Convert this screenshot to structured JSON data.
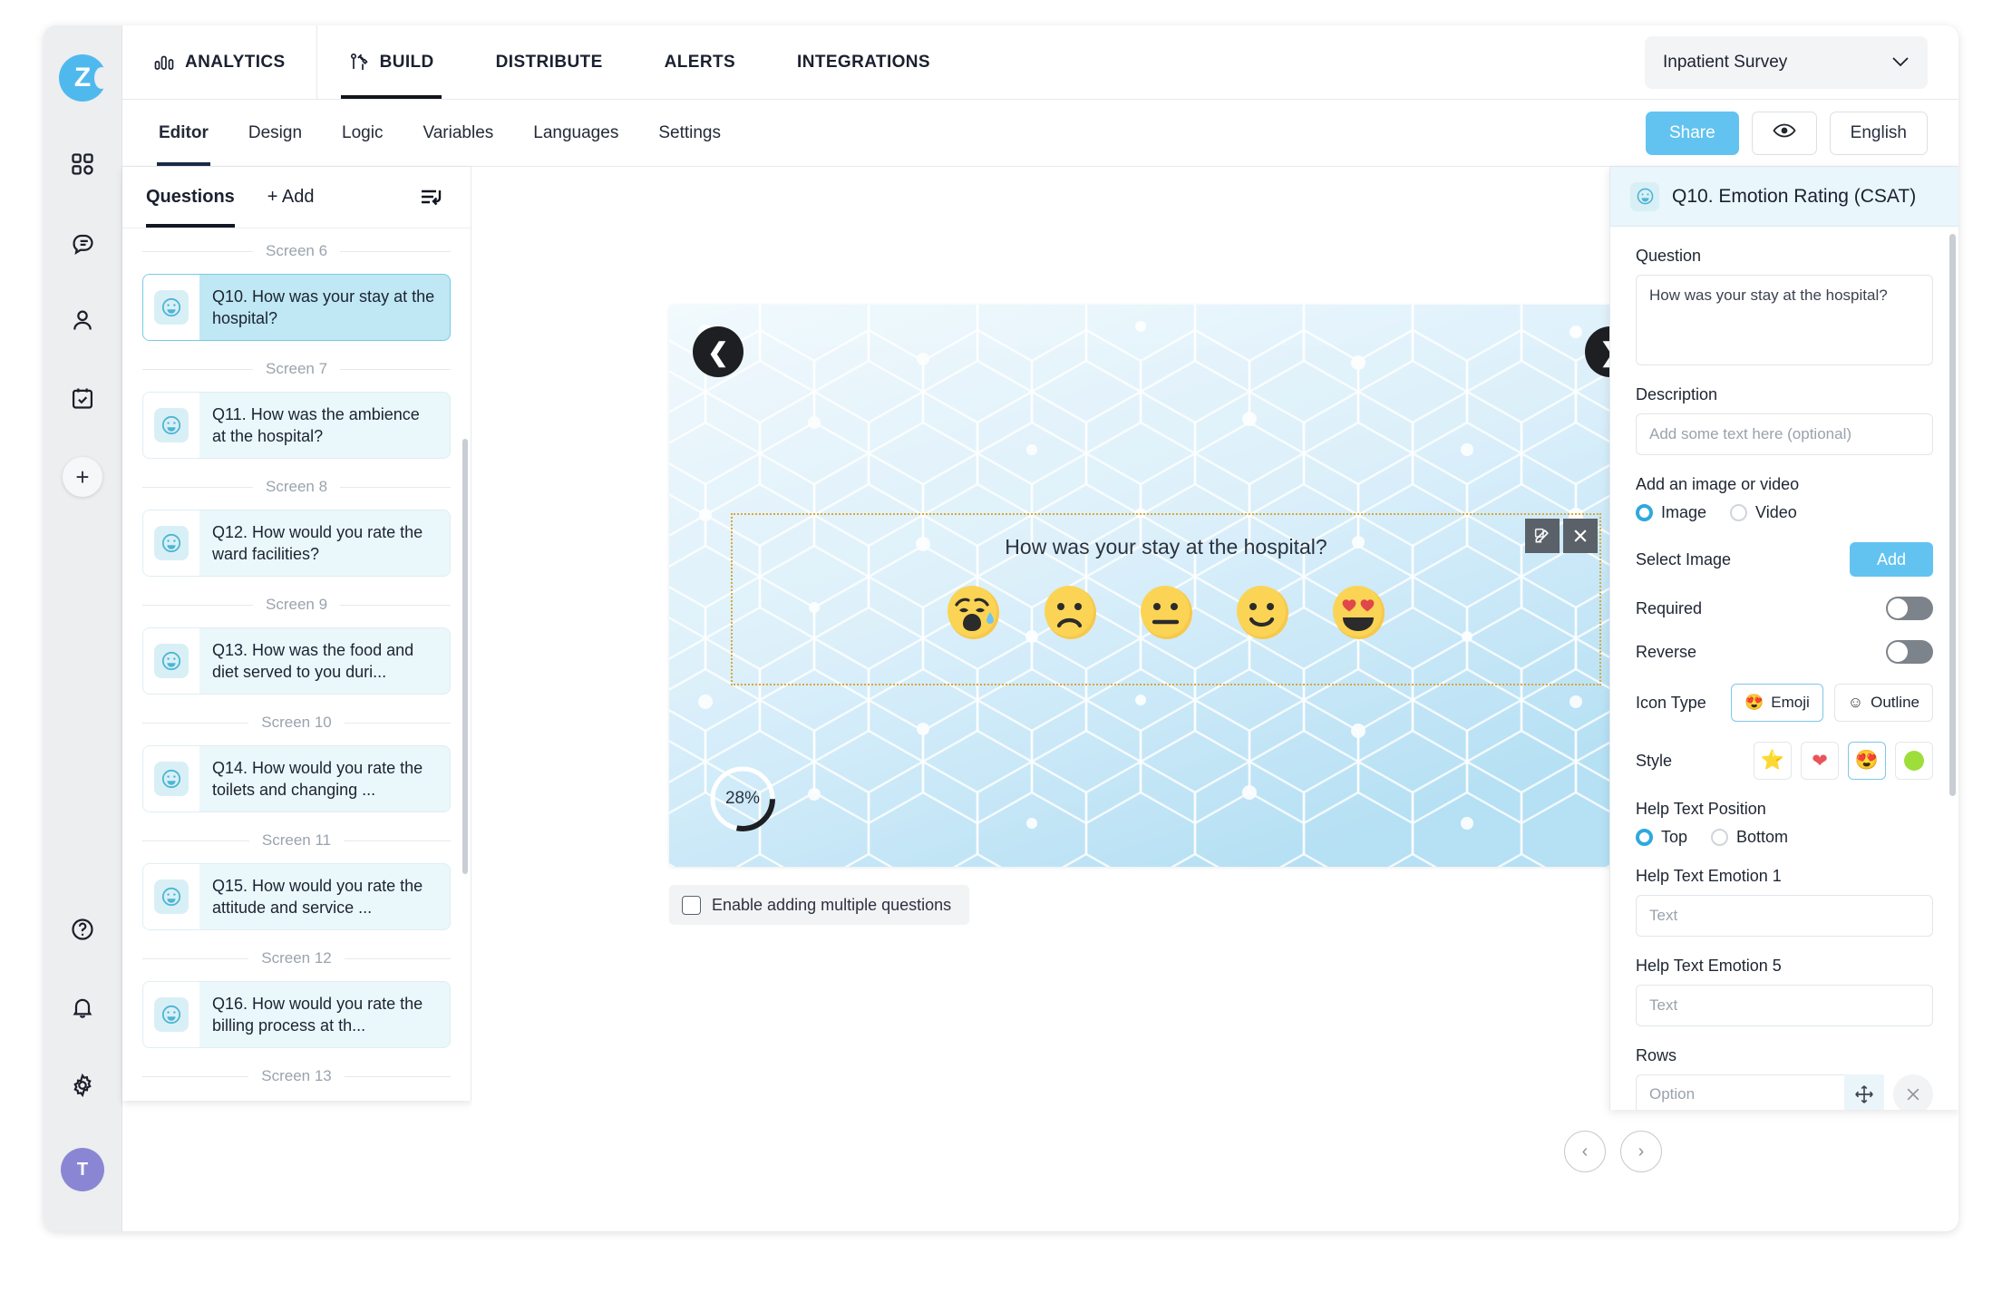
{
  "rail": {
    "logo_text": "Z",
    "items": [
      {
        "name": "dashboard-icon",
        "label": "Dashboard"
      },
      {
        "name": "feedback-icon",
        "label": "Feedback"
      },
      {
        "name": "contacts-icon",
        "label": "Contacts"
      },
      {
        "name": "tasks-icon",
        "label": "Tasks"
      }
    ],
    "add_label": "+",
    "bottom_items": [
      {
        "name": "help-icon",
        "label": "Help"
      },
      {
        "name": "notifications-icon",
        "label": "Notifications"
      },
      {
        "name": "settings-icon",
        "label": "Settings"
      }
    ],
    "avatar_initial": "T"
  },
  "topnav": {
    "items": [
      {
        "label": "ANALYTICS",
        "icon": "bar-chart-icon",
        "active": false
      },
      {
        "label": "BUILD",
        "icon": "tools-icon",
        "active": true
      },
      {
        "label": "DISTRIBUTE",
        "icon": "",
        "active": false
      },
      {
        "label": "ALERTS",
        "icon": "",
        "active": false
      },
      {
        "label": "INTEGRATIONS",
        "icon": "",
        "active": false
      }
    ],
    "survey_selected": "Inpatient Survey"
  },
  "subnav": {
    "items": [
      {
        "label": "Editor",
        "active": true
      },
      {
        "label": "Design",
        "active": false
      },
      {
        "label": "Logic",
        "active": false
      },
      {
        "label": "Variables",
        "active": false
      },
      {
        "label": "Languages",
        "active": false
      },
      {
        "label": "Settings",
        "active": false
      }
    ],
    "share_label": "Share",
    "preview_icon": "eye-icon",
    "language_label": "English"
  },
  "questions_panel": {
    "tab_label": "Questions",
    "add_label": "+ Add",
    "reorder_icon": "reorder-icon",
    "entries": [
      {
        "type": "screen",
        "label": "Screen 6"
      },
      {
        "type": "question",
        "label": "Q10. How was your stay at the hospital?",
        "selected": true
      },
      {
        "type": "screen",
        "label": "Screen 7"
      },
      {
        "type": "question",
        "label": "Q11. How was the ambience at the hospital?",
        "selected": false
      },
      {
        "type": "screen",
        "label": "Screen 8"
      },
      {
        "type": "question",
        "label": "Q12. How would you rate the ward facilities?",
        "selected": false
      },
      {
        "type": "screen",
        "label": "Screen 9"
      },
      {
        "type": "question",
        "label": "Q13. How was the food and diet served to you duri...",
        "selected": false
      },
      {
        "type": "screen",
        "label": "Screen 10"
      },
      {
        "type": "question",
        "label": "Q14. How would you rate the toilets and changing ...",
        "selected": false
      },
      {
        "type": "screen",
        "label": "Screen 11"
      },
      {
        "type": "question",
        "label": "Q15. How would you rate the attitude and service ...",
        "selected": false
      },
      {
        "type": "screen",
        "label": "Screen 12"
      },
      {
        "type": "question",
        "label": "Q16. How would you rate the billing process at th...",
        "selected": false
      },
      {
        "type": "screen",
        "label": "Screen 13"
      }
    ]
  },
  "canvas": {
    "prev_arrow": "❮",
    "next_arrow": "❯",
    "question_text": "How was your stay at the hospital?",
    "emotions": [
      "crying-face",
      "frowning-face",
      "neutral-face",
      "slightly-smiling-face",
      "heart-eyes-face"
    ],
    "progress_percent": "28%",
    "progress_value": 28,
    "edit_icon": "edit-icon",
    "close_icon": "close-icon",
    "multi_question_label": "Enable adding multiple questions",
    "pager_prev": "‹",
    "pager_next": "›"
  },
  "properties": {
    "title": "Q10. Emotion Rating (CSAT)",
    "question_label": "Question",
    "question_value": "How was your stay at the hospital?",
    "description_label": "Description",
    "description_placeholder": "Add some text here (optional)",
    "media_label": "Add an image or video",
    "media_options": [
      {
        "label": "Image",
        "selected": true
      },
      {
        "label": "Video",
        "selected": false
      }
    ],
    "select_image_label": "Select Image",
    "add_button_label": "Add",
    "required_label": "Required",
    "required_on": false,
    "reverse_label": "Reverse",
    "reverse_on": false,
    "icon_type_label": "Icon Type",
    "icon_types": [
      {
        "label": "Emoji",
        "glyph": "😍",
        "selected": true
      },
      {
        "label": "Outline",
        "glyph": "☺",
        "selected": false
      }
    ],
    "style_label": "Style",
    "styles": [
      {
        "name": "star-style",
        "glyph": "⭐",
        "selected": false
      },
      {
        "name": "heart-style",
        "glyph": "❤",
        "selected": false
      },
      {
        "name": "emoji-style",
        "glyph": "😍",
        "selected": true
      },
      {
        "name": "circle-style",
        "glyph": "",
        "selected": false
      }
    ],
    "help_position_label": "Help Text Position",
    "help_positions": [
      {
        "label": "Top",
        "selected": true
      },
      {
        "label": "Bottom",
        "selected": false
      }
    ],
    "help1_label": "Help Text Emotion 1",
    "help1_placeholder": "Text",
    "help5_label": "Help Text Emotion 5",
    "help5_placeholder": "Text",
    "rows_label": "Rows",
    "rows_placeholder": "Option",
    "rows_move_icon": "move-icon",
    "rows_delete_icon": "close-icon"
  },
  "colors": {
    "accent": "#62c3f0",
    "selected_card": "#bfe7f4",
    "canvas_bg": "#dcf0fa",
    "dark": "#121723"
  }
}
